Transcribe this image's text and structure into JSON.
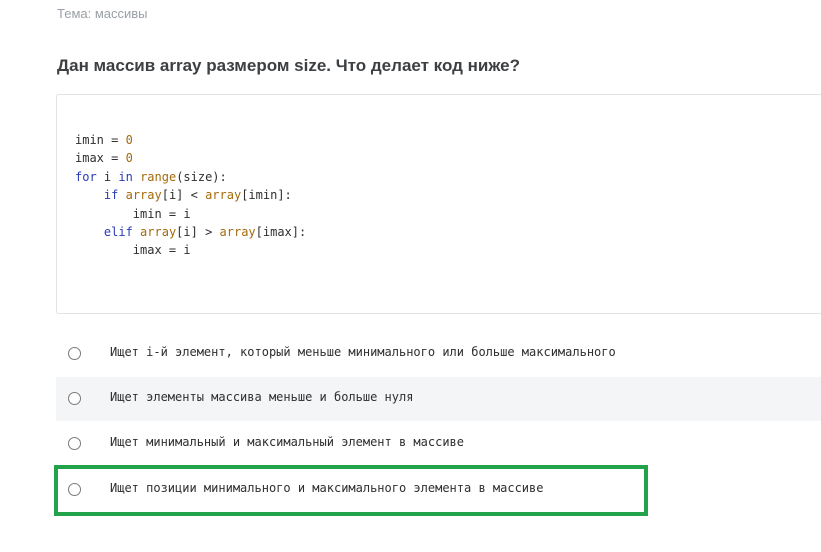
{
  "topic": "Тема: массивы",
  "question": "Дан массив array размером size. Что делает код ниже?",
  "code": {
    "line1_var": "imin",
    "line1_op": " = ",
    "line1_val": "0",
    "line2_var": "imax",
    "line2_op": " = ",
    "line2_val": "0",
    "line3_kw1": "for",
    "line3_a": " i ",
    "line3_kw2": "in",
    "line3_fn": "range",
    "line3_b": "(size):",
    "line4_indent": "    ",
    "line4_kw": "if",
    "line4_fn1": "array",
    "line4_a": "[i] < ",
    "line4_fn2": "array",
    "line4_b": "[imin]:",
    "line5": "        imin = i",
    "line6_indent": "    ",
    "line6_kw": "elif",
    "line6_fn1": "array",
    "line6_a": "[i] > ",
    "line6_fn2": "array",
    "line6_b": "[imax]:",
    "line7": "        imax = i"
  },
  "options": [
    {
      "label": "Ищет i-й элемент, который меньше минимального или больше максимального"
    },
    {
      "label": "Ищет элементы массива меньше и больше нуля"
    },
    {
      "label": "Ищет минимальный и максимальный элемент в массиве"
    },
    {
      "label": "Ищет позиции минимального и максимального элемента в массиве"
    }
  ],
  "colors": {
    "highlight": "#22a24a",
    "keyword": "#2b3bb5",
    "builtin": "#a46a0d"
  }
}
